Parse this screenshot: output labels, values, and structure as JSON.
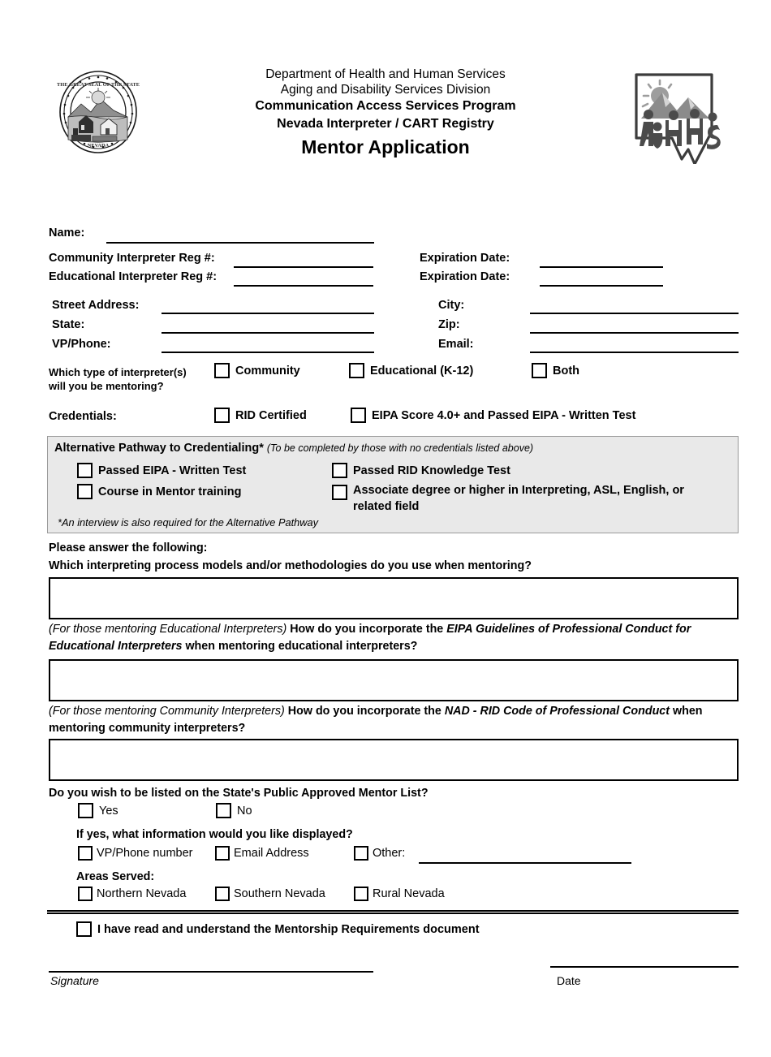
{
  "header": {
    "line1": "Department of Health and Human Services",
    "line2": "Aging and Disability Services Division",
    "line3": "Communication Access Services Program",
    "line4": "Nevada Interpreter / CART Registry",
    "title": "Mentor Application",
    "seal_alt": "Great Seal of the State of Nevada",
    "dhhs_alt": "DHHS Nevada logo"
  },
  "identity": {
    "name_label": "Name:",
    "name_value": "",
    "community_reg_label": "Community Interpreter Reg #:",
    "community_reg_value": "",
    "community_exp_label": "Expiration Date:",
    "community_exp_value": "",
    "educational_reg_label": "Educational Interpreter Reg #:",
    "educational_reg_value": "",
    "educational_exp_label": "Expiration Date:",
    "educational_exp_value": ""
  },
  "address": {
    "street_label": "Street Address:",
    "street_value": "",
    "city_label": "City:",
    "city_value": "",
    "state_label": "State:",
    "state_value": "",
    "zip_label": "Zip:",
    "zip_value": "",
    "phone_label": "VP/Phone:",
    "phone_value": "",
    "email_label": "Email:",
    "email_value": ""
  },
  "interpreter_type": {
    "question_line1": "Which type of interpreter(s)",
    "question_line2": "will you be mentoring?",
    "options": [
      {
        "label": "Community",
        "checked": false
      },
      {
        "label": "Educational (K-12)",
        "checked": false
      },
      {
        "label": "Both",
        "checked": false
      }
    ]
  },
  "credentials": {
    "label": "Credentials:",
    "options": [
      {
        "label": "RID Certified",
        "checked": false
      },
      {
        "label": "EIPA Score 4.0+ and Passed EIPA - Written Test",
        "checked": false
      }
    ]
  },
  "alternative_pathway": {
    "title": "Alternative Pathway to Credentialing*",
    "title_note": "(To be completed by those with no credentials listed above)",
    "options": [
      {
        "label": "Passed EIPA - Written Test",
        "checked": false
      },
      {
        "label": "Passed RID Knowledge Test",
        "checked": false
      },
      {
        "label": "Course in Mentor training",
        "checked": false
      },
      {
        "label": "Associate degree or higher in Interpreting, ASL, English, or",
        "label2": "related field",
        "checked": false
      }
    ],
    "footnote": "*An interview is also required for the Alternative Pathway"
  },
  "questions": {
    "intro": "Please answer the following:",
    "q1": {
      "text": "Which interpreting process models and/or methodologies do you use when mentoring?",
      "answer": ""
    },
    "q2": {
      "prefix": "(For those mentoring Educational Interpreters)",
      "part1": "How do you incorporate the ",
      "emphasis": "EIPA Guidelines of Professional Conduct for Educational Interpreters",
      "part2": " when mentoring educational interpreters?",
      "answer": ""
    },
    "q3": {
      "prefix": "(For those mentoring Community Interpreters)",
      "part1": "How do you incorporate the ",
      "emphasis": "NAD - RID Code of Professional Conduct",
      "part2": " when mentoring community interpreters?",
      "answer": ""
    }
  },
  "public_list": {
    "question": "Do you wish to be listed on the State's Public Approved Mentor List?",
    "yes_label": "Yes",
    "no_label": "No",
    "subquestion": "If yes, what information would you like displayed?",
    "display_options": [
      {
        "label": "VP/Phone number",
        "checked": false
      },
      {
        "label": "Email Address",
        "checked": false
      },
      {
        "label": "Other:",
        "checked": false
      }
    ],
    "other_value": "",
    "areas_label": "Areas Served:",
    "areas": [
      {
        "label": "Northern Nevada",
        "checked": false
      },
      {
        "label": "Southern Nevada",
        "checked": false
      },
      {
        "label": "Rural Nevada",
        "checked": false
      }
    ]
  },
  "attestation": {
    "label": "I have read and understand the Mentorship Requirements document",
    "checked": false
  },
  "signature": {
    "signature_label": "Signature",
    "signature_value": "",
    "date_label": "Date",
    "date_value": ""
  },
  "colors": {
    "panel_background": "#e9e9e9",
    "panel_border": "#9a9a9a",
    "ink": "#000000",
    "paper": "#ffffff"
  }
}
